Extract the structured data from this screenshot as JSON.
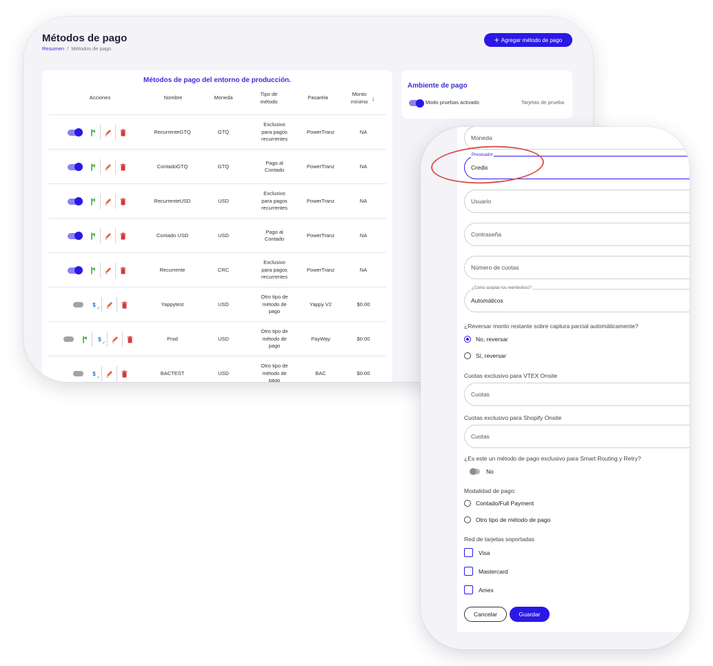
{
  "header": {
    "title": "Métodos de pago",
    "breadcrumb": {
      "home": "Resumen",
      "separator": "/",
      "current": "Métodos de pago"
    },
    "add_button": "Agregar método de pago"
  },
  "table": {
    "title": "Métodos de pago del entorno de producción.",
    "columns": {
      "acciones": "Acciones",
      "nombre": "Nombre",
      "moneda": "Moneda",
      "tipo": "Tipo de\nmétodo",
      "pasarela": "Pasarela",
      "monto": "Monto\nmínimo"
    },
    "rows": [
      {
        "nombre": "RecurrenteGTQ",
        "moneda": "GTQ",
        "tipo": "Exclusivo\npara pagos\nrecurrentes",
        "pasarela": "PowerTranz",
        "monto": "NA",
        "enabled": true
      },
      {
        "nombre": "ContadoGTQ",
        "moneda": "GTQ",
        "tipo": "Pago al\nContado",
        "pasarela": "PowerTranz",
        "monto": "NA",
        "enabled": true
      },
      {
        "nombre": "RecurrenteUSD",
        "moneda": "USD",
        "tipo": "Exclusivo\npara pagos\nrecurrentes",
        "pasarela": "PowerTranz",
        "monto": "NA",
        "enabled": true
      },
      {
        "nombre": "Contado USD",
        "moneda": "USD",
        "tipo": "Pago al\nContado",
        "pasarela": "PowerTranz",
        "monto": "NA",
        "enabled": true
      },
      {
        "nombre": "Recurrente",
        "moneda": "CRC",
        "tipo": "Exclusivo\npara pagos\nrecurrentes",
        "pasarela": "PowerTranz",
        "monto": "NA",
        "enabled": true
      },
      {
        "nombre": "Yappytest",
        "moneda": "USD",
        "tipo": "Otro tipo de\nmétodo de\npago",
        "pasarela": "Yappy V2",
        "monto": "$0.00",
        "enabled": false
      },
      {
        "nombre": "Prod",
        "moneda": "USD",
        "tipo": "Otro tipo de\nmétodo de\npago",
        "pasarela": "PayWay",
        "monto": "$0.00",
        "enabled": false
      },
      {
        "nombre": "BACTEST",
        "moneda": "USD",
        "tipo": "Otro tipo de\nmétodo de\npago",
        "pasarela": "BAC",
        "monto": "$0.00",
        "enabled": false
      }
    ]
  },
  "ambiente": {
    "title": "Ambiente de pago",
    "toggle_label": "Modo pruebas activado",
    "link": "Tarjetas de prueba"
  },
  "form": {
    "moneda_placeholder": "Moneda",
    "procesador_label": "Procesador",
    "procesador_value": "Credix",
    "usuario_placeholder": "Usuario",
    "contrasena_placeholder": "Contraseña",
    "cuotas_placeholder": "Número de cuotas",
    "reembolsos_label": "¿Como aceptar los reembolsos?",
    "reembolsos_value": "Automáticos",
    "reversar_question": "¿Reversar monto restante sobre captura parcial automáticamente?",
    "reversar_no": "No, reversar",
    "reversar_si": "Sí, reversar",
    "vtex_label": "Cuotas exclusivo para VTEX Onsite",
    "vtex_placeholder": "Cuotas",
    "shopify_label": "Cuotas exclusivo para Shopify Onsite",
    "shopify_placeholder": "Cuotas",
    "smart_question": "¿Es este un método de pago exclusivo para Smart Routing y Retry?",
    "smart_value": "No",
    "modalidad_label": "Modalidad de pago:",
    "modalidad_contado": "Contado/Full Payment",
    "modalidad_otro": "Otro tipo de método de pago",
    "red_label": "Red de tarjetas soportadas",
    "cards": [
      "Visa",
      "Mastercard",
      "Amex"
    ],
    "cancel_button": "Cancelar",
    "save_button": "Guardar"
  },
  "colors": {
    "accent": "#2a18e6",
    "annotation": "#d9534f",
    "delete": "#d33b3b",
    "edit": "#e2663a",
    "flow": "#3daa3d"
  }
}
